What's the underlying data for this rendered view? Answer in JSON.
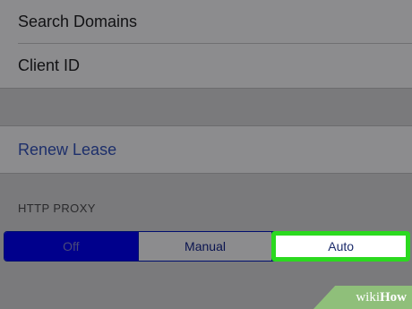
{
  "dhcp_fields": [
    {
      "label": "Search Domains"
    },
    {
      "label": "Client ID"
    }
  ],
  "renew_lease_label": "Renew Lease",
  "http_proxy": {
    "header": "HTTP PROXY",
    "options": [
      "Off",
      "Manual",
      "Auto"
    ],
    "selected": "Auto"
  },
  "watermark": {
    "prefix": "wiki",
    "suffix": "How"
  },
  "colors": {
    "highlight": "#2bd91f",
    "segment_selected_fill": "#00008c",
    "link": "#1d2f6b"
  }
}
